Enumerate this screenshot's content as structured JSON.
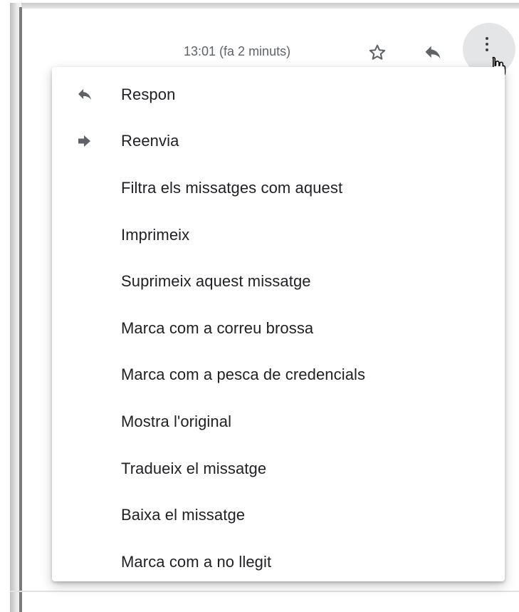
{
  "header": {
    "time_text": "13:01 (fa 2 minuts)",
    "icons": {
      "star": "star-outline-icon",
      "reply": "reply-icon",
      "more": "more-vertical-icon",
      "cursor": "hand-pointer-cursor"
    }
  },
  "menu": {
    "items": [
      {
        "label": "Respon",
        "icon": "reply-icon"
      },
      {
        "label": "Reenvia",
        "icon": "forward-icon"
      },
      {
        "label": "Filtra els missatges com aquest"
      },
      {
        "label": "Imprimeix"
      },
      {
        "label": "Suprimeix aquest missatge"
      },
      {
        "label": "Marca com a correu brossa"
      },
      {
        "label": "Marca com a pesca de credencials"
      },
      {
        "label": "Mostra l'original"
      },
      {
        "label": "Tradueix el missatge"
      },
      {
        "label": "Baixa el missatge"
      },
      {
        "label": "Marca com a no llegit"
      }
    ]
  },
  "colors": {
    "icon_gray": "#5f6368",
    "text": "#202124",
    "more_button_bg": "#e4e5e6"
  }
}
